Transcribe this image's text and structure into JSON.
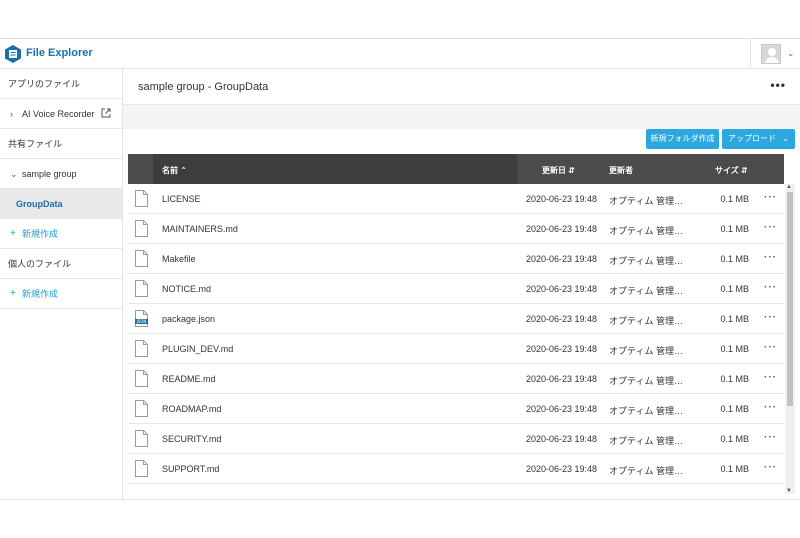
{
  "app": {
    "title": "File Explorer"
  },
  "sidebar": {
    "my_files_heading": "アプリのファイル",
    "app_item": "AI Voice Recorder",
    "shared_heading": "共有ファイル",
    "group_item": "sample group",
    "active_item": "GroupData",
    "new_shared": "新規作成",
    "personal_heading": "個人のファイル",
    "new_personal": "新規作成"
  },
  "main": {
    "breadcrumb": "sample group - GroupData",
    "more": "•••",
    "btn_new_folder": "新規フォルダ作成",
    "btn_upload": "アップロード"
  },
  "table": {
    "columns": {
      "name": "名前",
      "modified": "更新日",
      "updater": "更新者",
      "size": "サイズ"
    },
    "rows": [
      {
        "name": "LICENSE",
        "date": "2020-06-23 19:48",
        "user": "オプティム 管理…",
        "size": "0.1 MB",
        "icon": "file-icon"
      },
      {
        "name": "MAINTAINERS.md",
        "date": "2020-06-23 19:48",
        "user": "オプティム 管理…",
        "size": "0.1 MB",
        "icon": "file-icon"
      },
      {
        "name": "Makefile",
        "date": "2020-06-23 19:48",
        "user": "オプティム 管理…",
        "size": "0.1 MB",
        "icon": "file-icon"
      },
      {
        "name": "NOTICE.md",
        "date": "2020-06-23 19:48",
        "user": "オプティム 管理…",
        "size": "0.1 MB",
        "icon": "file-icon"
      },
      {
        "name": "package.json",
        "date": "2020-06-23 19:48",
        "user": "オプティム 管理…",
        "size": "0.1 MB",
        "icon": "json-file-icon"
      },
      {
        "name": "PLUGIN_DEV.md",
        "date": "2020-06-23 19:48",
        "user": "オプティム 管理…",
        "size": "0.1 MB",
        "icon": "file-icon"
      },
      {
        "name": "README.md",
        "date": "2020-06-23 19:48",
        "user": "オプティム 管理…",
        "size": "0.1 MB",
        "icon": "file-icon"
      },
      {
        "name": "ROADMAP.md",
        "date": "2020-06-23 19:48",
        "user": "オプティム 管理…",
        "size": "0.1 MB",
        "icon": "file-icon"
      },
      {
        "name": "SECURITY.md",
        "date": "2020-06-23 19:48",
        "user": "オプティム 管理…",
        "size": "0.1 MB",
        "icon": "file-icon"
      },
      {
        "name": "SUPPORT.md",
        "date": "2020-06-23 19:48",
        "user": "オプティム 管理…",
        "size": "0.1 MB",
        "icon": "file-icon"
      }
    ]
  },
  "colors": {
    "accent": "#2ba8e0",
    "brand": "#1a6fa8",
    "header_dark": "#4b4b4b"
  }
}
